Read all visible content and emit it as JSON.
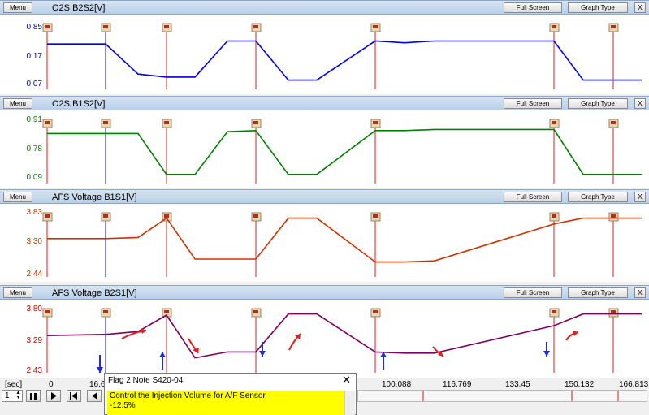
{
  "panels": [
    {
      "title": "O2S B2S2[V]",
      "y_labels": [
        "0.85",
        "0.17",
        "0.07"
      ],
      "y_color": "#0000cc",
      "line_color": "#0000e0",
      "series": [
        0.7,
        0.7,
        0.2,
        0.15,
        0.15,
        0.75,
        0.75,
        0.1,
        0.1,
        0.75,
        0.72,
        0.75,
        0.75,
        0.1,
        0.1
      ]
    },
    {
      "title": "O2S B1S2[V]",
      "y_labels": [
        "0.91",
        "0.78",
        "0.09"
      ],
      "y_color": "#008000",
      "line_color": "#008000",
      "series": [
        0.8,
        0.8,
        0.8,
        0.1,
        0.1,
        0.83,
        0.85,
        0.1,
        0.1,
        0.85,
        0.85,
        0.87,
        0.87,
        0.1,
        0.1
      ]
    },
    {
      "title": "AFS Voltage B1S1[V]",
      "y_labels": [
        "3.83",
        "3.30",
        "2.44"
      ],
      "y_color": "#cc3300",
      "line_color": "#cc3300",
      "series": [
        0.6,
        0.6,
        0.62,
        0.95,
        0.25,
        0.25,
        0.25,
        0.95,
        0.95,
        0.2,
        0.2,
        0.22,
        0.85,
        0.95,
        0.95
      ]
    },
    {
      "title": "AFS Voltage B2S1[V]",
      "y_labels": [
        "3.80",
        "3.29",
        "2.43"
      ],
      "y_color": "#cc0000",
      "line_color": "#800060",
      "series": [
        0.58,
        0.6,
        0.65,
        0.93,
        0.2,
        0.3,
        0.3,
        0.95,
        0.95,
        0.3,
        0.28,
        0.28,
        0.75,
        0.95,
        0.95
      ]
    }
  ],
  "buttons": {
    "menu": "Menu",
    "full_screen": "Full Screen",
    "graph_type": "Graph Type",
    "close": "X"
  },
  "x_axis": {
    "unit": "[sec]",
    "ticks": [
      "0",
      "16.6",
      "100.088",
      "116.769",
      "133.45",
      "150.132",
      "166.813"
    ]
  },
  "playback": {
    "step_value": "1"
  },
  "popup": {
    "title": "Flag 2 Note S420-04",
    "close": "✕",
    "line1": "Control the Injection Volume for A/F Sensor",
    "line2": "-12.5%"
  },
  "flag_colors": {
    "flag": "#b03020",
    "flag_bg": "#e8d8b0",
    "marker_red": "#d02020",
    "marker_blue": "#1010a0"
  },
  "annotations": {
    "arrow_color_red": "#e02020",
    "arrow_color_blue": "#2030d0"
  }
}
